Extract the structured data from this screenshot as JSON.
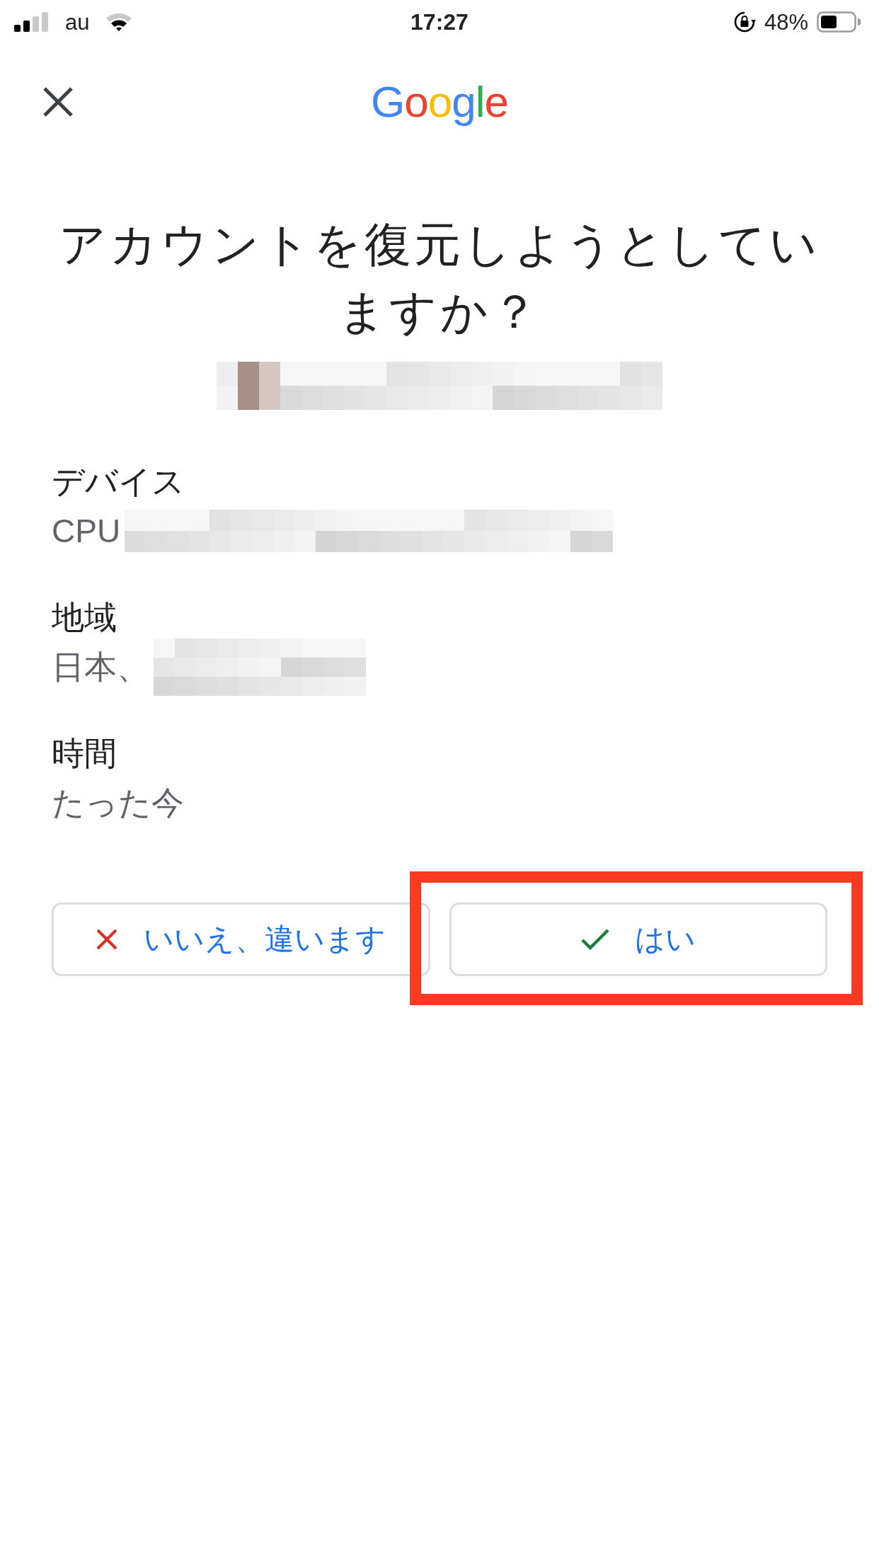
{
  "status_bar": {
    "carrier": "au",
    "time": "17:27",
    "battery_percent": "48%"
  },
  "header": {
    "logo": "Google"
  },
  "title": "アカウントを復元しようとしていますか？",
  "account": {
    "redacted": true
  },
  "details": [
    {
      "label": "デバイス",
      "value": "CPU",
      "redacted": true
    },
    {
      "label": "地域",
      "value": "日本、",
      "redacted": true
    },
    {
      "label": "時間",
      "value": "たった今",
      "redacted": false
    }
  ],
  "buttons": [
    {
      "kind": "deny",
      "label": "いいえ、違います",
      "highlighted": false
    },
    {
      "kind": "confirm",
      "label": "はい",
      "highlighted": true
    }
  ]
}
